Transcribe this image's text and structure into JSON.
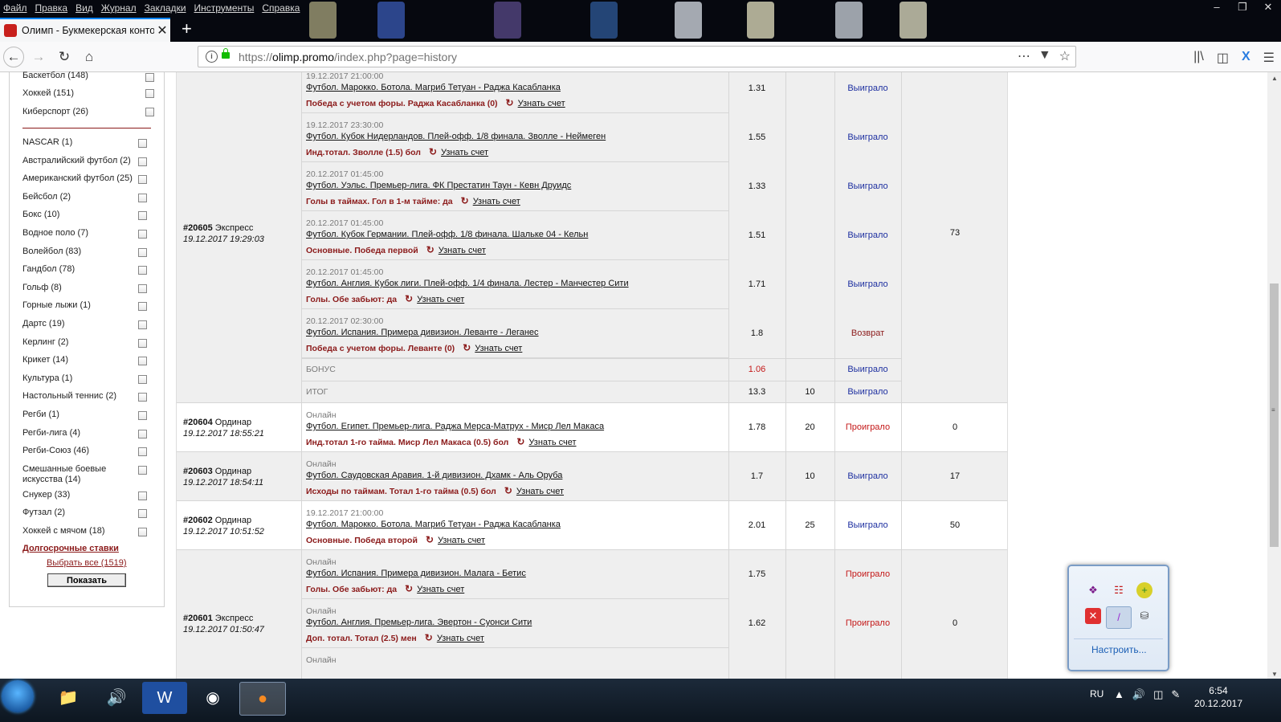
{
  "menubar": [
    "Файл",
    "Правка",
    "Вид",
    "Журнал",
    "Закладки",
    "Инструменты",
    "Справка"
  ],
  "tab": {
    "title": "Олимп - Букмекерская контор"
  },
  "url": {
    "domain": "olimp.promo",
    "prefix": "https://",
    "path": "/index.php?page=history"
  },
  "sidebar": {
    "items_top": [
      {
        "label": "Баскетбол (148)"
      },
      {
        "label": "Хоккей (151)"
      },
      {
        "label": "Киберспорт (26)"
      }
    ],
    "items": [
      {
        "label": "NASCAR (1)"
      },
      {
        "label": "Австралийский футбол (2)"
      },
      {
        "label": "Американский футбол (25)"
      },
      {
        "label": "Бейсбол (2)"
      },
      {
        "label": "Бокс (10)"
      },
      {
        "label": "Водное поло (7)"
      },
      {
        "label": "Волейбол (83)"
      },
      {
        "label": "Гандбол (78)"
      },
      {
        "label": "Гольф (8)"
      },
      {
        "label": "Горные лыжи (1)"
      },
      {
        "label": "Дартс (19)"
      },
      {
        "label": "Керлинг (2)"
      },
      {
        "label": "Крикет (14)"
      },
      {
        "label": "Культура (1)"
      },
      {
        "label": "Настольный теннис (2)"
      },
      {
        "label": "Регби (1)"
      },
      {
        "label": "Регби-лига (4)"
      },
      {
        "label": "Регби-Союз (46)"
      },
      {
        "label": "Смешанные боевые искусства (14)"
      },
      {
        "label": "Снукер (33)"
      },
      {
        "label": "Футзал (2)"
      },
      {
        "label": "Хоккей с мячом (18)"
      }
    ],
    "long_bets": "Долгосрочные ставки",
    "select_all": "Выбрать все (1519)",
    "show_button": "Показать"
  },
  "bets": [
    {
      "id": "#20605",
      "type": "Экспресс",
      "date": "19.12.2017 19:29:03",
      "win": "73",
      "events": [
        {
          "date": "19.12.2017 21:00:00",
          "title": "Футбол. Марокко. Ботола. Магриб Тетуан - Раджа Касабланка",
          "market": "Победа с учетом форы. Раджа Касабланка (0)",
          "odds": "1.31",
          "stake": "",
          "result": "Выиграло",
          "status": "win"
        },
        {
          "date": "19.12.2017 23:30:00",
          "title": "Футбол. Кубок Нидерландов. Плей-офф. 1/8 финала. Зволле - Неймеген",
          "market": "Инд.тотал. Зволле (1.5) бол",
          "odds": "1.55",
          "stake": "",
          "result": "Выиграло",
          "status": "win"
        },
        {
          "date": "20.12.2017 01:45:00",
          "title": "Футбол. Уэльс. Премьер-лига. ФК Престатин Таун - Кевн Друидс",
          "market": "Голы в таймах. Гол в 1-м тайме: да",
          "odds": "1.33",
          "stake": "",
          "result": "Выиграло",
          "status": "win"
        },
        {
          "date": "20.12.2017 01:45:00",
          "title": "Футбол. Кубок Германии. Плей-офф. 1/8 финала. Шальке 04 - Кельн",
          "market": "Основные. Победа первой",
          "odds": "1.51",
          "stake": "",
          "result": "Выиграло",
          "status": "win"
        },
        {
          "date": "20.12.2017 01:45:00",
          "title": "Футбол. Англия. Кубок лиги. Плей-офф. 1/4 финала. Лестер - Манчестер Сити",
          "market": "Голы. Обе забьют: да",
          "odds": "1.71",
          "stake": "",
          "result": "Выиграло",
          "status": "win"
        },
        {
          "date": "20.12.2017 02:30:00",
          "title": "Футбол. Испания. Примера дивизион. Леванте - Леганес",
          "market": "Победа с учетом форы. Леванте (0)",
          "odds": "1.8",
          "stake": "",
          "result": "Возврат",
          "status": "ret"
        }
      ],
      "bonus": {
        "label": "БОНУС",
        "odds": "1.06",
        "result": "Выиграло"
      },
      "total": {
        "label": "ИТОГ",
        "odds": "13.3",
        "stake": "10",
        "result": "Выиграло"
      }
    },
    {
      "id": "#20604",
      "type": "Ординар",
      "date": "19.12.2017 18:55:21",
      "win": "0",
      "events": [
        {
          "date": "Онлайн",
          "title": "Футбол. Египет. Премьер-лига. Раджа Мерса-Матрух - Миср Лел Макаса",
          "market": "Инд.тотал 1-го тайма. Миср Лел Макаса (0.5) бол",
          "odds": "1.78",
          "stake": "20",
          "result": "Проиграло",
          "status": "lose"
        }
      ]
    },
    {
      "id": "#20603",
      "type": "Ординар",
      "date": "19.12.2017 18:54:11",
      "win": "17",
      "events": [
        {
          "date": "Онлайн",
          "title": "Футбол. Саудовская Аравия. 1-й дивизион. Дхамк - Аль Оруба",
          "market": "Исходы по таймам. Тотал 1-го тайма (0.5) бол",
          "odds": "1.7",
          "stake": "10",
          "result": "Выиграло",
          "status": "win"
        }
      ]
    },
    {
      "id": "#20602",
      "type": "Ординар",
      "date": "19.12.2017 10:51:52",
      "win": "50",
      "events": [
        {
          "date": "19.12.2017 21:00:00",
          "title": "Футбол. Марокко. Ботола. Магриб Тетуан - Раджа Касабланка",
          "market": "Основные. Победа второй",
          "odds": "2.01",
          "stake": "25",
          "result": "Выиграло",
          "status": "win"
        }
      ]
    },
    {
      "id": "#20601",
      "type": "Экспресс",
      "date": "19.12.2017 01:50:47",
      "win": "0",
      "events": [
        {
          "date": "Онлайн",
          "title": "Футбол. Испания. Примера дивизион. Малага - Бетис",
          "market": "Голы. Обе забьют: да",
          "odds": "1.75",
          "stake": "",
          "result": "Проиграло",
          "status": "lose"
        },
        {
          "date": "Онлайн",
          "title": "Футбол. Англия. Премьер-лига. Эвертон - Суонси Сити",
          "market": "Доп. тотал. Тотал (2.5) мен",
          "odds": "1.62",
          "stake": "",
          "result": "Проиграло",
          "status": "lose"
        },
        {
          "date": "Онлайн",
          "title": "",
          "market": "",
          "odds": "",
          "stake": "",
          "result": "",
          "status": ""
        }
      ]
    }
  ],
  "score_link": "Узнать счет",
  "tray": {
    "configure": "Настроить..."
  },
  "taskbar": {
    "lang": "RU",
    "time": "6:54",
    "date": "20.12.2017"
  },
  "colors": {
    "win": "#1d2fa0",
    "lose": "#c41818",
    "return": "#8b1a1a",
    "accent": "#8b1a1a"
  }
}
